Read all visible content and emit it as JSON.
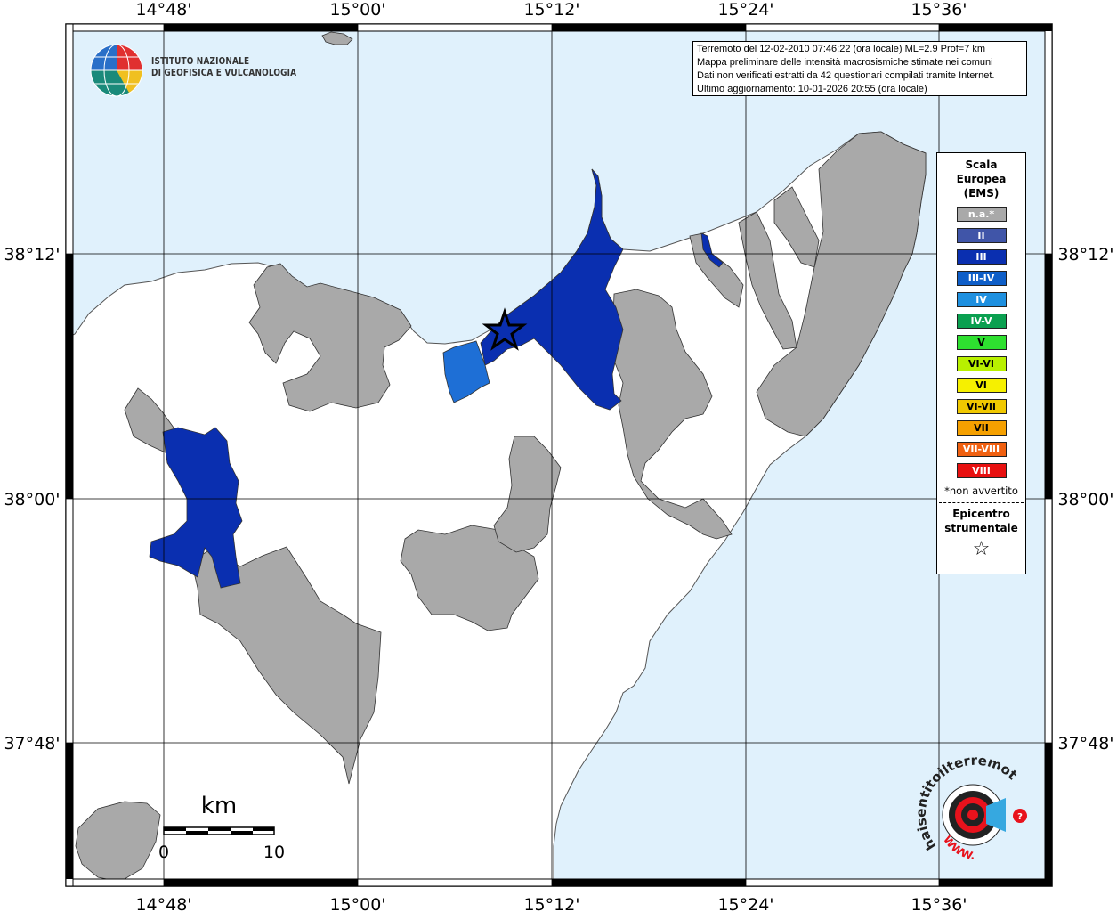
{
  "info": {
    "lines": [
      "Terremoto del 12-02-2010 07:46:22 (ora locale) ML=2.9 Prof=7 km",
      "Mappa preliminare delle intensità macrosismiche stimate nei comuni",
      "Dati non verificati estratti da 42 questionari compilati tramite Internet.",
      "Ultimo aggiornamento: 10-01-2026 20:55 (ora locale)"
    ]
  },
  "institute": {
    "line1": "ISTITUTO NAZIONALE",
    "line2": "DI GEOFISICA E VULCANOLOGIA"
  },
  "longitude_labels": [
    "14°48'",
    "15°00'",
    "15°12'",
    "15°24'",
    "15°36'"
  ],
  "latitude_labels": [
    "38°12'",
    "38°00'",
    "37°48'"
  ],
  "scale_bar": {
    "unit": "km",
    "min": "0",
    "max": "10"
  },
  "legend": {
    "title": [
      "Scala",
      "Europea",
      "(EMS)"
    ],
    "items": [
      {
        "label": "n.a.*",
        "color": "#a9a9a9"
      },
      {
        "label": "II",
        "color": "#4055a8"
      },
      {
        "label": "III",
        "color": "#0a2fb0"
      },
      {
        "label": "III-IV",
        "color": "#0e5ec8"
      },
      {
        "label": "IV",
        "color": "#1e90e0"
      },
      {
        "label": "IV-V",
        "color": "#0aa050"
      },
      {
        "label": "V",
        "color": "#2ee030"
      },
      {
        "label": "VI-VI",
        "color": "#b8f000"
      },
      {
        "label": "VI",
        "color": "#f6f000"
      },
      {
        "label": "VI-VII",
        "color": "#f0c800"
      },
      {
        "label": "VII",
        "color": "#f5a000"
      },
      {
        "label": "VII-VIII",
        "color": "#f06010"
      },
      {
        "label": "VIII",
        "color": "#e81010"
      }
    ],
    "note": "*non avvertito",
    "epicenter": [
      "Epicentro",
      "strumentale"
    ],
    "epicenter_symbol": "☆"
  },
  "watermark": {
    "text": "haisentitoilterremoto.it",
    "url": "WWW."
  },
  "colors": {
    "sea": "#e0f1fc",
    "land": "#ffffff",
    "na": "#a9a9a9",
    "int_iii": "#0a2fb0",
    "int_iv": "#1e6fd6",
    "border": "#000000"
  }
}
